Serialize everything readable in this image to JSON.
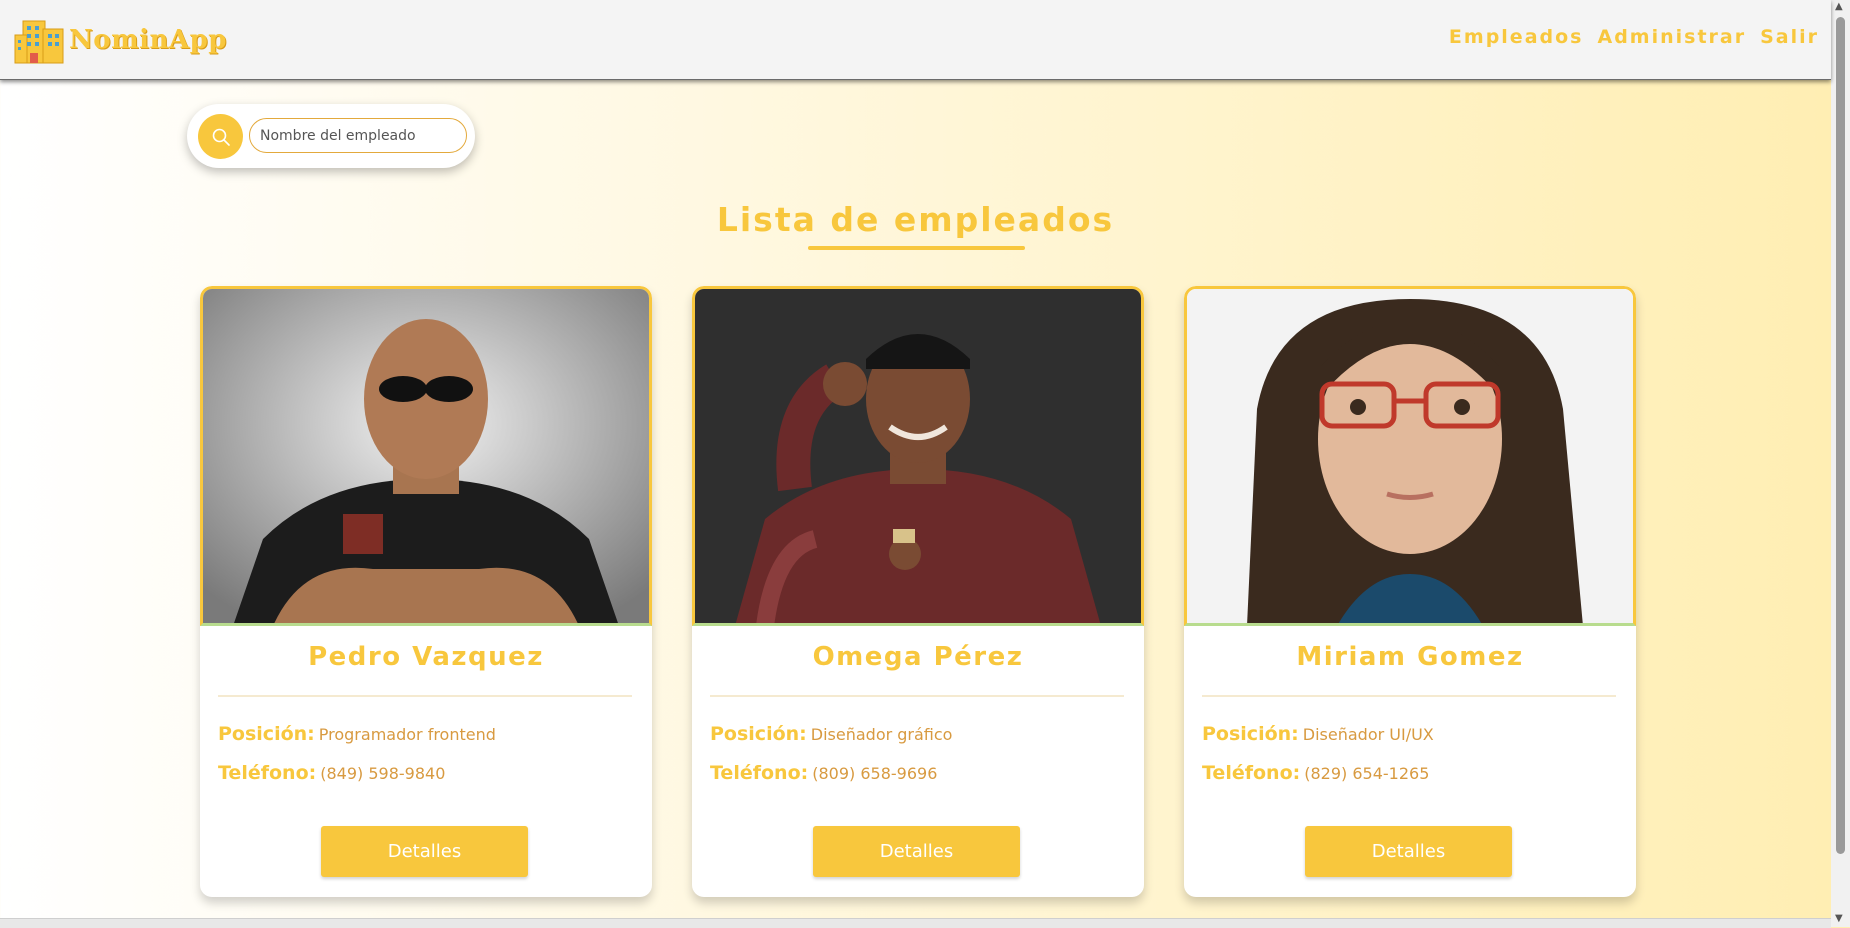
{
  "app": {
    "name": "NominApp"
  },
  "nav": {
    "items": [
      "Empleados",
      "Administrar",
      "Salir"
    ]
  },
  "search": {
    "placeholder": "Nombre del empleado"
  },
  "page": {
    "title": "Lista de empleados"
  },
  "labels": {
    "position": "Posición:",
    "phone": "Teléfono:",
    "details_button": "Detalles"
  },
  "employees": [
    {
      "name": "Pedro Vazquez",
      "position": "Programador frontend",
      "phone": "(849) 598-9840"
    },
    {
      "name": "Omega Pérez",
      "position": "Diseñador gráfico",
      "phone": "(809) 658-9696"
    },
    {
      "name": "Miriam Gomez",
      "position": "Diseñador UI/UX",
      "phone": "(829) 654-1265"
    }
  ],
  "colors": {
    "accent": "#f8c73d",
    "text_warm": "#d89a40",
    "navbar": "#f4f4f4"
  }
}
